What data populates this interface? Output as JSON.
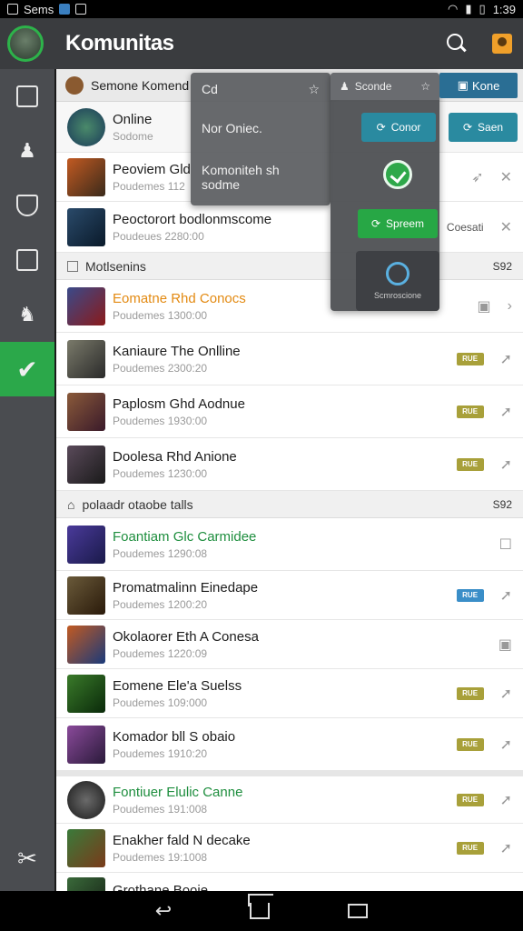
{
  "status": {
    "app": "Sems",
    "time": "1:39"
  },
  "app_bar": {
    "title": "Komunitas"
  },
  "top_strip": {
    "label": "Semone Komend"
  },
  "online_row": {
    "name": "Online",
    "sub": "Sodome"
  },
  "popup": {
    "header": "Cd",
    "line1": "Nor Oniec.",
    "line2": "Komoniteh sh sodme"
  },
  "popup2": {
    "header": "Sconde",
    "btn_contact": "Conor",
    "btn_save": "Spreem",
    "tool_label": "Scmroscione"
  },
  "kom_chip": "Kone",
  "side_btn_right": "Saen",
  "rows_top": [
    {
      "name": "Peoviem Gld",
      "sub": "Poudemes 112",
      "color": ""
    },
    {
      "name": "Peoctorort bodlonmscome",
      "sub": "Poudeues 2280:00",
      "color": "",
      "tag": "Coesati"
    }
  ],
  "section1": {
    "label": "Motlsenins",
    "count": "S92"
  },
  "rows_mid": [
    {
      "name": "Eomatne Rhd Conocs",
      "sub": "Poudemes 1300:00",
      "color": "orange",
      "badge": ""
    },
    {
      "name": "Kaniaure The Onlline",
      "sub": "Poudemes 2300:20",
      "color": "",
      "badge": "olive"
    },
    {
      "name": "Paplosm Ghd Aodnue",
      "sub": "Poudemes 1930:00",
      "color": "",
      "badge": "olive"
    },
    {
      "name": "Doolesa Rhd Anione",
      "sub": "Poudemes 1230:00",
      "color": "",
      "badge": "olive"
    }
  ],
  "section2": {
    "label": "polaadr otaobe talls",
    "count": "S92"
  },
  "rows_bottom": [
    {
      "name": "Foantiam Glc Carmidee",
      "sub": "Poudemes 1290:08",
      "color": "green",
      "badge": ""
    },
    {
      "name": "Promatmalinn Einedape",
      "sub": "Poudemes 1200:20",
      "color": "",
      "badge": "blue"
    },
    {
      "name": "Okolaorer Eth A Conesa",
      "sub": "Poudemes 1220:09",
      "color": "",
      "badge": ""
    },
    {
      "name": "Eomene Ele'a Suelss",
      "sub": "Poudemes 109:000",
      "color": "",
      "badge": "olive"
    },
    {
      "name": "Komador bll S obaio",
      "sub": "Poudemes 1910:20",
      "color": "",
      "badge": "olive"
    },
    {
      "name": "Fontiuer Elulic Canne",
      "sub": "Poudemes 191:008",
      "color": "green",
      "badge": "olive"
    },
    {
      "name": "Enakher fald N decake",
      "sub": "Poudemes 19:1008",
      "color": "",
      "badge": "olive"
    },
    {
      "name": "Grothane Booie",
      "sub": "",
      "color": "",
      "badge": ""
    }
  ],
  "badge_text": "RUE",
  "colors": {
    "accent": "#2ba84a",
    "appbar": "#3a3c3f",
    "sidebar": "#4a4c50",
    "teal": "#2a8aa0"
  }
}
